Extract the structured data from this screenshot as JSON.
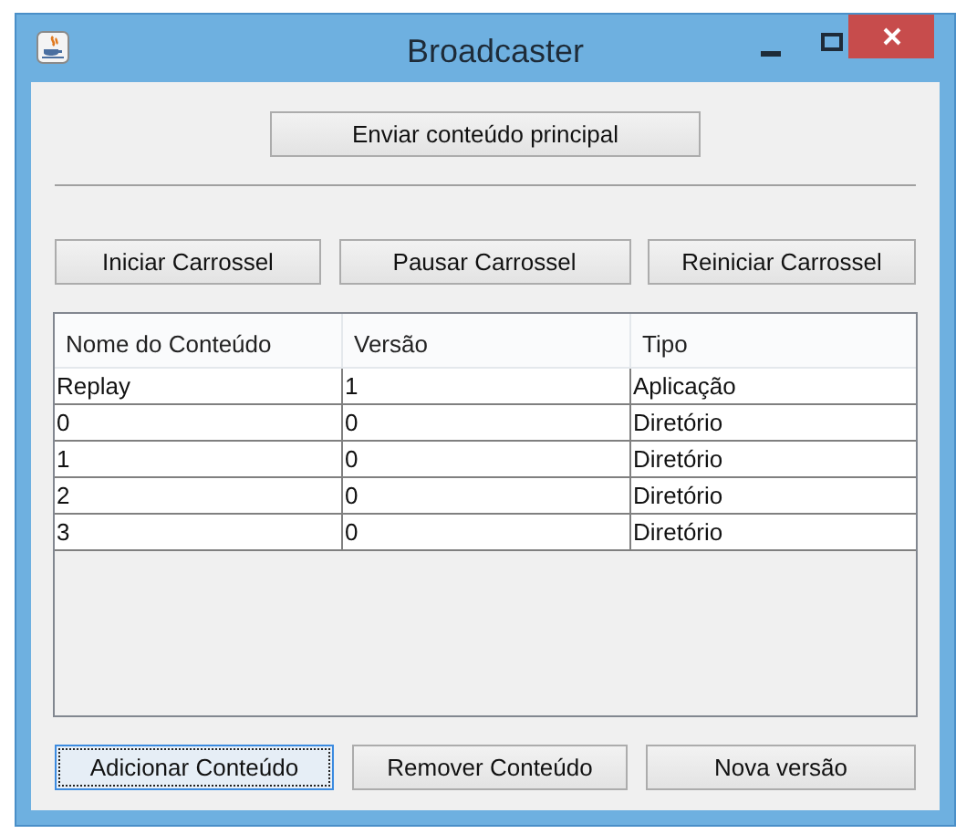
{
  "window": {
    "title": "Broadcaster"
  },
  "main_button": {
    "label": "Enviar conteúdo principal",
    "focused": false
  },
  "carousel_buttons": [
    {
      "label": "Iniciar Carrossel",
      "focused": false
    },
    {
      "label": "Pausar Carrossel",
      "focused": false
    },
    {
      "label": "Reiniciar Carrossel",
      "focused": false
    }
  ],
  "table": {
    "columns": [
      "Nome do Conteúdo",
      "Versão",
      "Tipo"
    ],
    "rows": [
      [
        "Replay",
        "1",
        "Aplicação"
      ],
      [
        "0",
        "0",
        "Diretório"
      ],
      [
        "1",
        "0",
        "Diretório"
      ],
      [
        "2",
        "0",
        "Diretório"
      ],
      [
        "3",
        "0",
        "Diretório"
      ]
    ]
  },
  "bottom_buttons": [
    {
      "label": "Adicionar Conteúdo",
      "focused": true
    },
    {
      "label": "Remover Conteúdo",
      "focused": false
    },
    {
      "label": "Nova versão",
      "focused": false
    }
  ]
}
